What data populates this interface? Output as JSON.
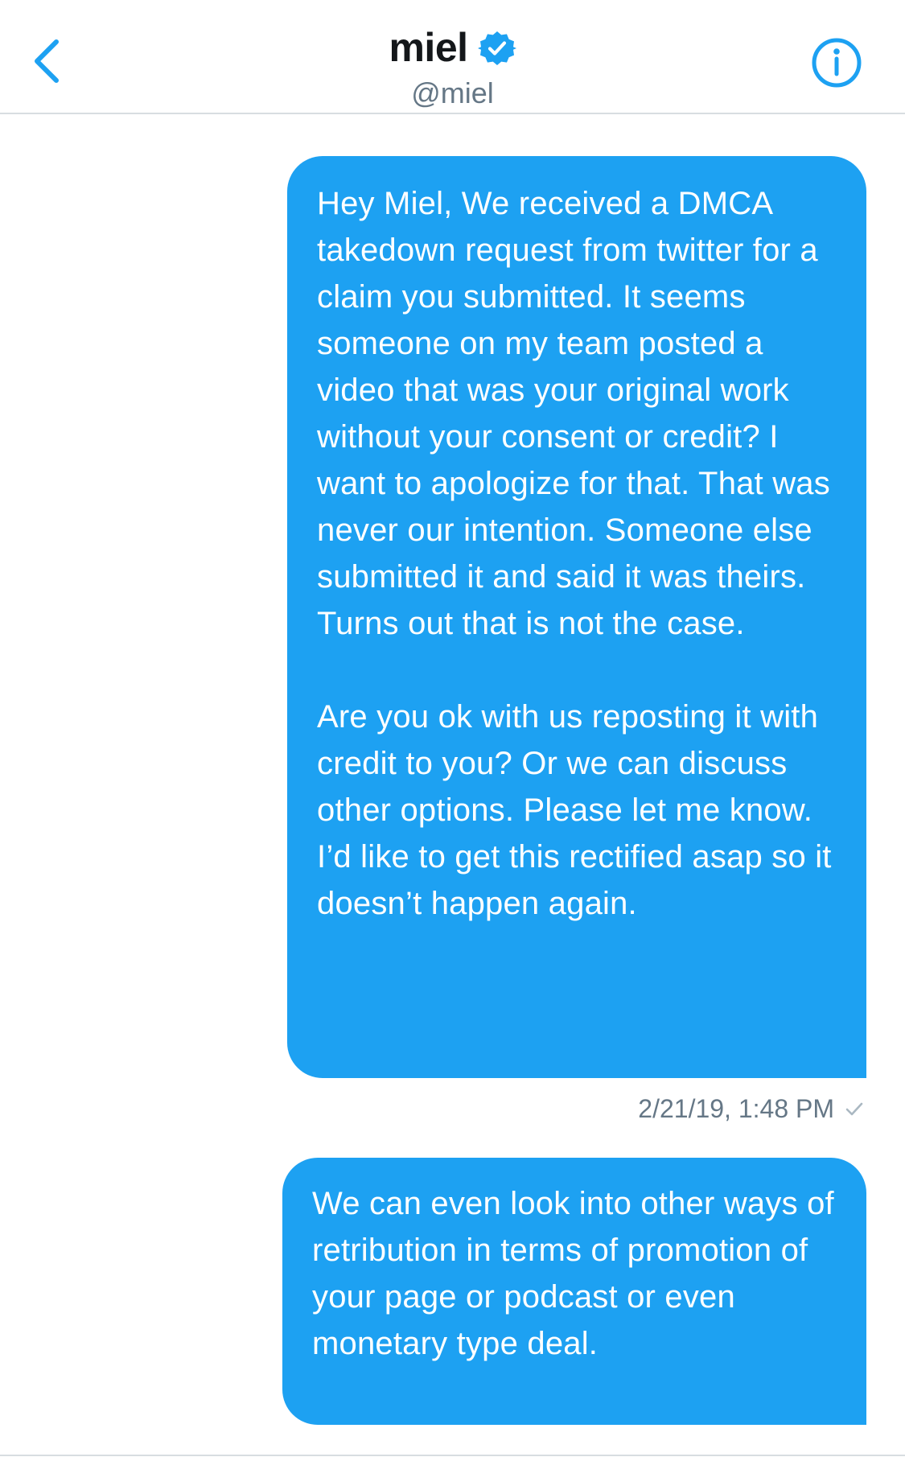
{
  "header": {
    "name": "miel",
    "handle": "@miel",
    "icons": {
      "back": "chevron-left-icon",
      "verified": "verified-badge-icon",
      "info": "info-icon"
    },
    "accent_color": "#1da1f2"
  },
  "messages": [
    {
      "text": "Hey Miel, We received a DMCA takedown request from twitter for a claim you submitted. It seems someone on my team posted a video that was your original work without your consent or credit? I want to apologize for that. That was never our intention. Someone else submitted it and said it was theirs. Turns out that is not the case.\n\nAre you ok with us reposting it with credit to you? Or we can discuss other options. Please let me know. I’d like to get this rectified asap so it doesn’t happen again.",
      "timestamp": "2/21/19, 1:48 PM",
      "status_icon": "checkmark-icon"
    },
    {
      "text": "We can even look into other ways of retribution in terms of promotion of your page or podcast or even monetary type deal."
    }
  ],
  "colors": {
    "bubble": "#1da1f2",
    "text_on_bubble": "#ffffff",
    "meta_text": "#657786",
    "divider": "#d8dde1"
  }
}
